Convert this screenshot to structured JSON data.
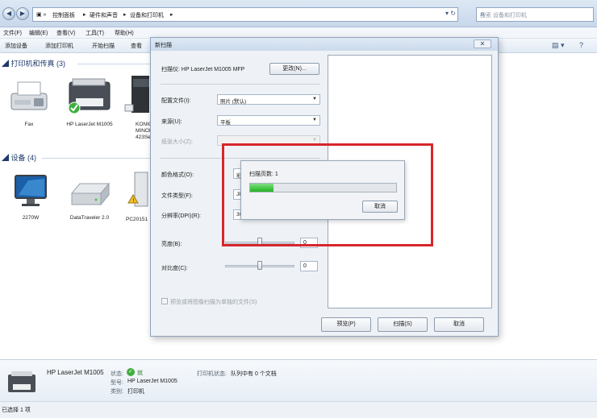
{
  "window": {
    "breadcrumbs": [
      "控制面板",
      "硬件和声音",
      "设备和打印机"
    ],
    "search_placeholder": "搜索 设备和打印机"
  },
  "menu": [
    "文件(F)",
    "编辑(E)",
    "查看(V)",
    "工具(T)",
    "帮助(H)"
  ],
  "toolbar": [
    "添加设备",
    "添加打印机",
    "开始扫描",
    "查看"
  ],
  "groups": {
    "printers": {
      "label": "打印机和传真 (3)",
      "items": [
        {
          "name": "Fax",
          "icon": "fax-icon"
        },
        {
          "name": "HP LaserJet M1005",
          "icon": "printer-icon"
        },
        {
          "name": "KONICA MINOLTA 423Series",
          "icon": "copier-icon"
        }
      ]
    },
    "devices": {
      "label": "设备 (4)",
      "items": [
        {
          "name": "2270W",
          "icon": "monitor-icon"
        },
        {
          "name": "DataTraveler 2.0",
          "icon": "drive-icon"
        },
        {
          "name": "PC20151",
          "icon": "computer-tower-icon"
        }
      ]
    }
  },
  "details": {
    "printer_name": "HP LaserJet M1005",
    "status_label": "状态:",
    "status_value": "就",
    "model_label": "型号:",
    "model_value": "HP LaserJet M1005",
    "category_label": "类别:",
    "category_value": "打印机",
    "queue_label": "打印机状态:",
    "queue_value": "队列中有 0 个文档"
  },
  "statusbar": {
    "text": "已选择 1 项"
  },
  "scan_dialog": {
    "title": "新扫描",
    "scanner_label": "扫描仪: HP LaserJet M1005 MFP",
    "change_button": "更改(N)...",
    "profile_label": "配置文件(I):",
    "profile_value": "照片 (默认)",
    "source_label": "来源(U):",
    "source_value": "平板",
    "paper_label": "纸张大小(Z):",
    "color_label": "颜色格式(O):",
    "color_value": "彩",
    "filetype_label": "文件类型(F):",
    "filetype_value": "JP",
    "resolution_label": "分辨率(DPI)(R):",
    "resolution_value": "30",
    "brightness_label": "亮度(B):",
    "brightness_value": "0",
    "contrast_label": "对比度(C):",
    "contrast_value": "0",
    "checkbox_label": "预览或将图像扫描为单独的文件(S)",
    "preview_button": "预览(P)",
    "scan_button": "扫描(S)",
    "cancel_button": "取消"
  },
  "progress_popup": {
    "pages_label": "扫描页数: 1",
    "progress": 0.16,
    "cancel_button": "取消"
  },
  "colors": {
    "highlight": "#d7262b",
    "progress": "#22b322"
  }
}
